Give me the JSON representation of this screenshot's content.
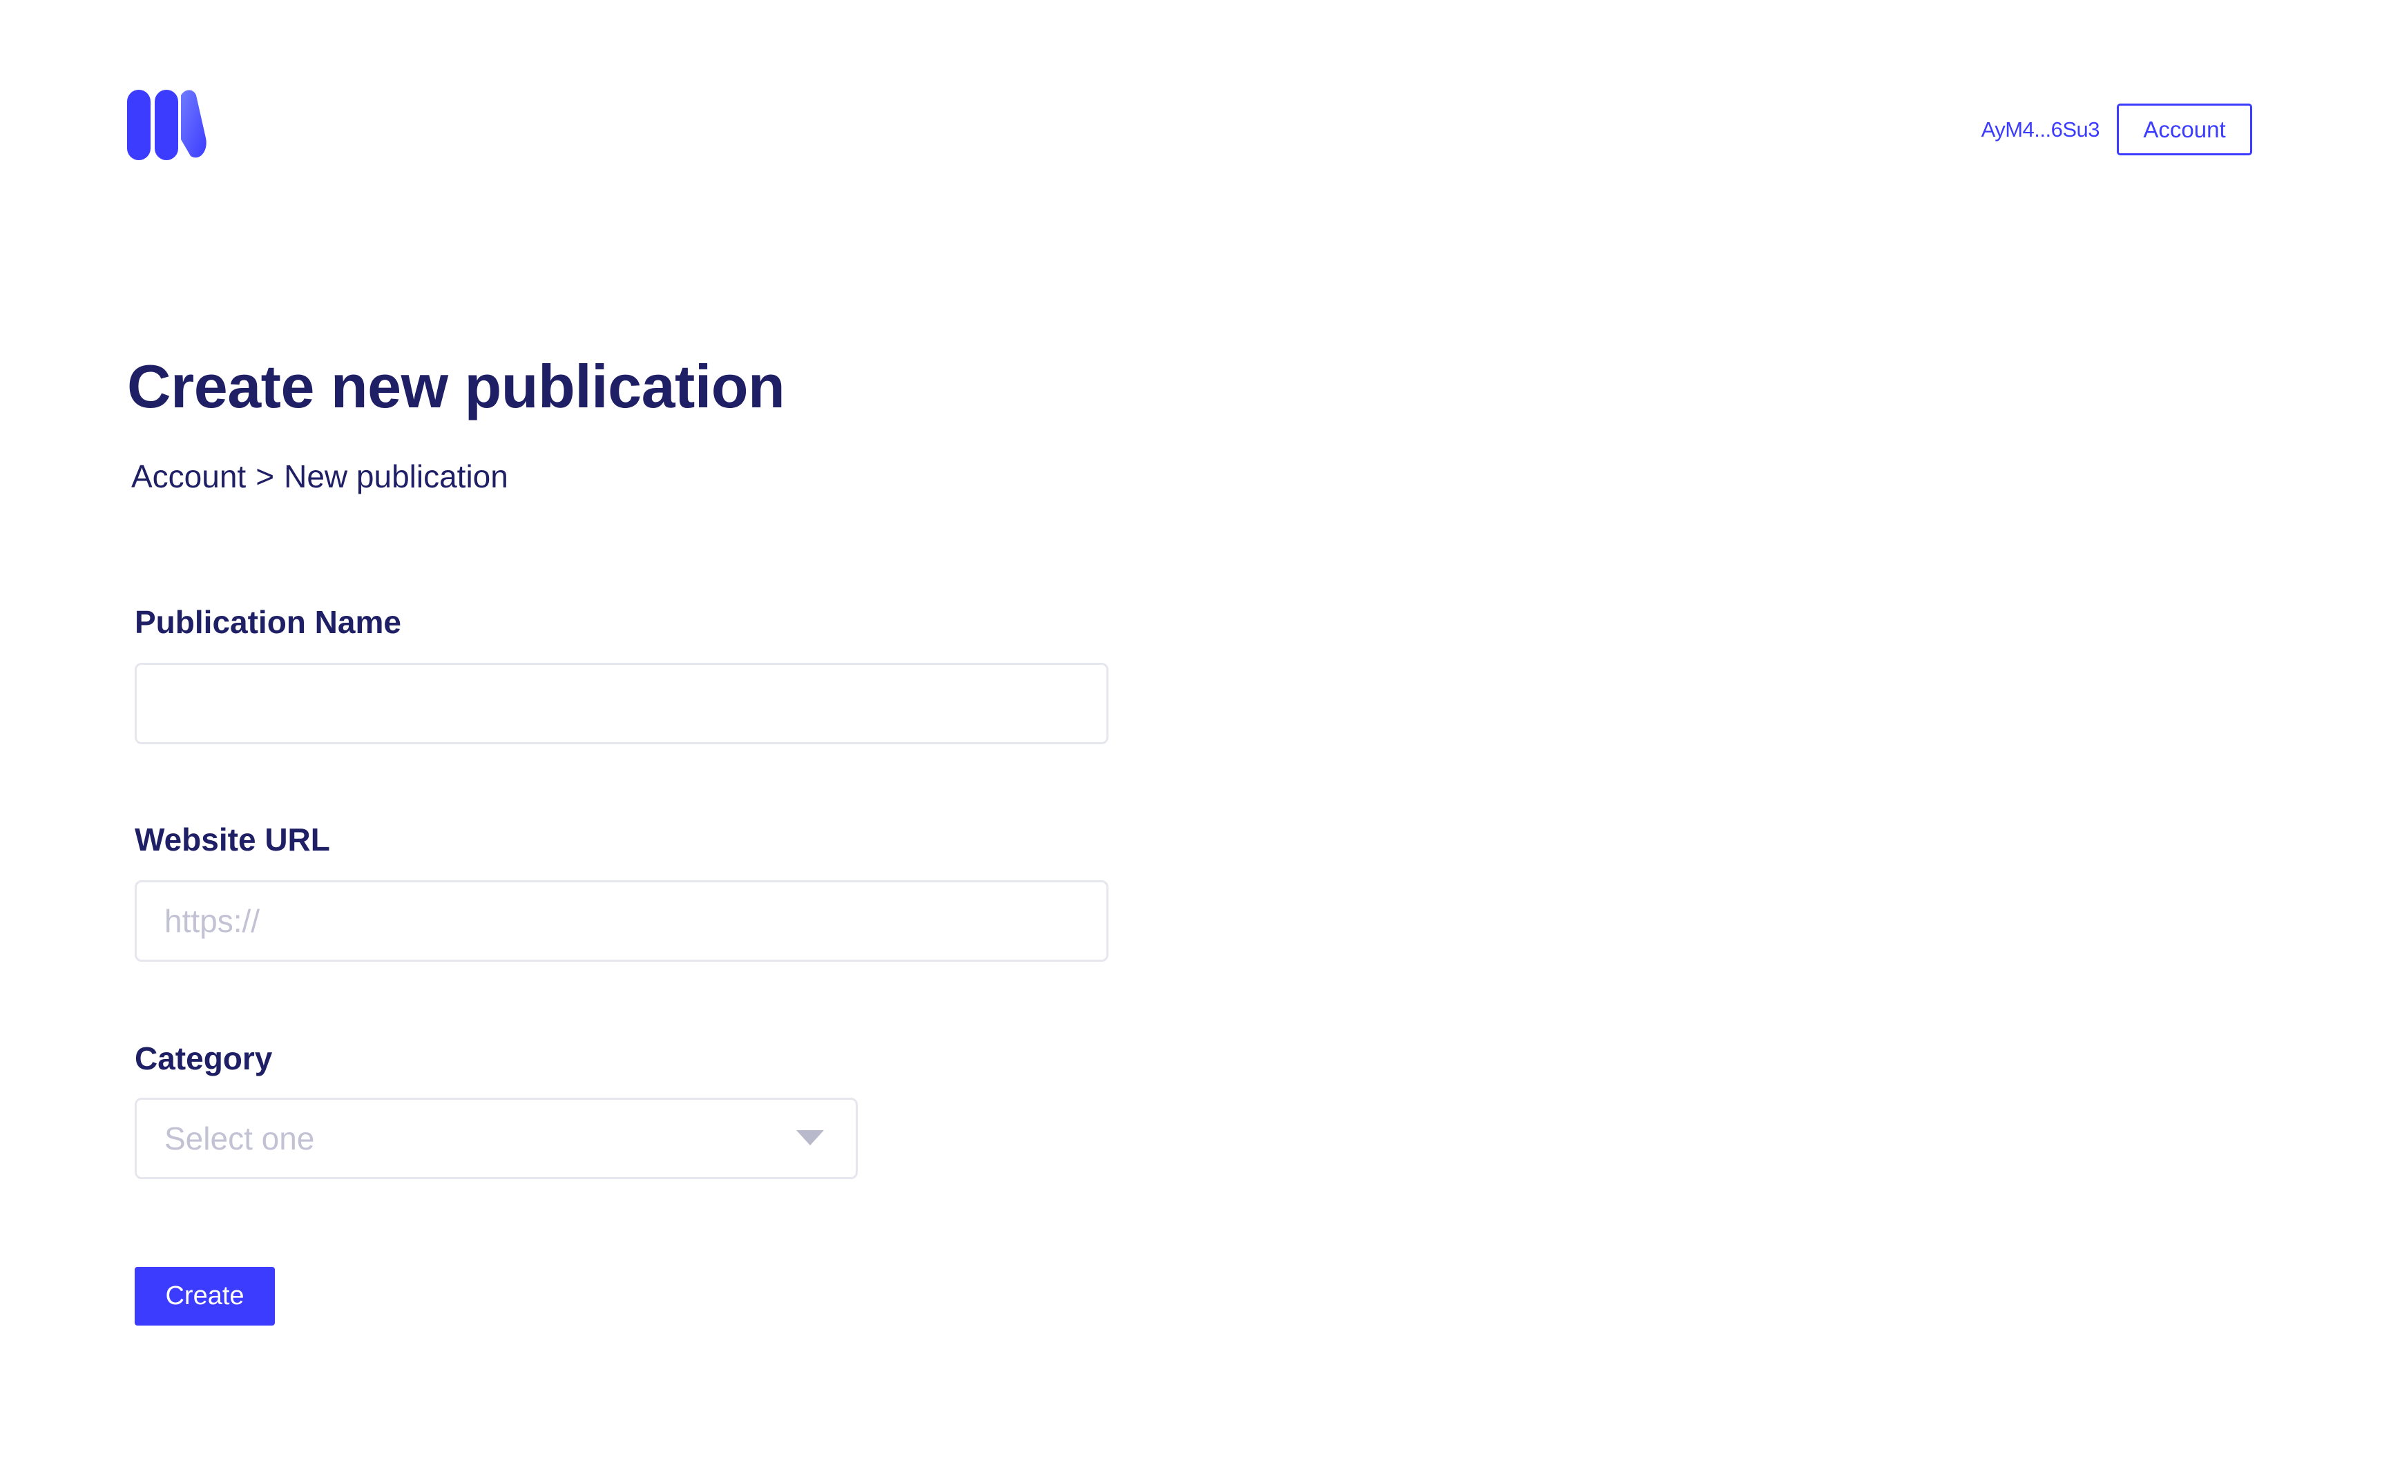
{
  "header": {
    "logo_icon": "brand-logo-icon",
    "wallet_address": "AyM4...6Su3",
    "account_button_label": "Account"
  },
  "page": {
    "title": "Create new publication",
    "breadcrumb": {
      "parent": "Account",
      "separator": ">",
      "current": "New publication"
    }
  },
  "form": {
    "publication_name": {
      "label": "Publication Name",
      "value": "",
      "placeholder": ""
    },
    "website_url": {
      "label": "Website URL",
      "value": "",
      "placeholder": "https://"
    },
    "category": {
      "label": "Category",
      "selected": "Select one",
      "caret_icon": "caret-down-icon"
    },
    "create_button_label": "Create"
  },
  "colors": {
    "accent": "#3c3cff",
    "heading": "#1f1f66",
    "border": "#e6e6ee",
    "placeholder": "#c2c2d4"
  }
}
